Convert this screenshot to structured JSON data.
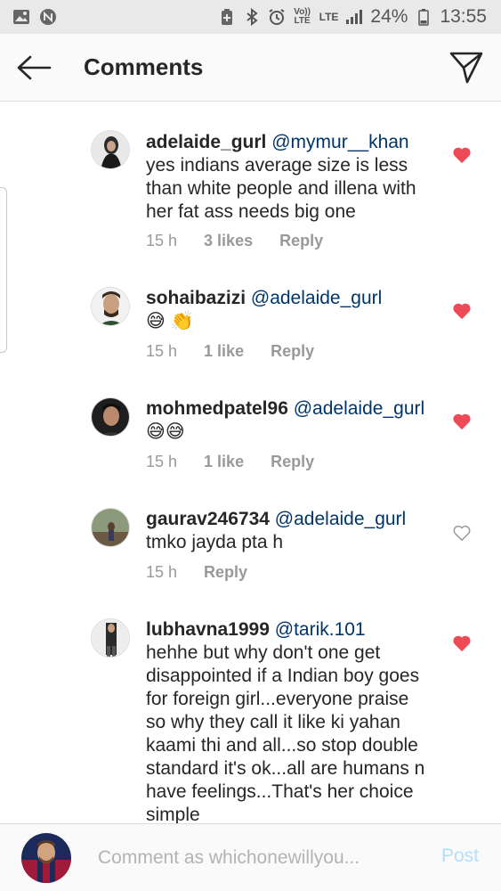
{
  "status_bar": {
    "volte": "Vo)) LTE",
    "lte": "LTE",
    "battery": "24%",
    "time": "13:55",
    "icons": [
      "gallery-icon",
      "navigation-app-icon",
      "battery-saver-icon",
      "bluetooth-icon",
      "alarm-icon",
      "volte-icon",
      "lte-icon",
      "signal-icon",
      "battery-icon"
    ]
  },
  "header": {
    "title": "Comments",
    "back_icon": "back-arrow-icon",
    "send_icon": "direct-send-icon"
  },
  "comments": [
    {
      "username": "adelaide_gurl",
      "mention": "@mymur__khan",
      "text": "yes indians average size is less than white people and illena with her fat ass needs big one",
      "time": "15 h",
      "likes": "3 likes",
      "reply": "Reply",
      "liked": true
    },
    {
      "username": "sohaibazizi",
      "mention": "@adelaide_gurl",
      "text": "😅 👏",
      "time": "15 h",
      "likes": "1 like",
      "reply": "Reply",
      "liked": true
    },
    {
      "username": "mohmedpatel96",
      "mention": "@adelaide_gurl",
      "text": "😅😅",
      "time": "15 h",
      "likes": "1 like",
      "reply": "Reply",
      "liked": true
    },
    {
      "username": "gaurav246734",
      "mention": "@adelaide_gurl",
      "text": "tmko jayda pta h",
      "time": "15 h",
      "likes": "",
      "reply": "Reply",
      "liked": false
    },
    {
      "username": "lubhavna1999",
      "mention": "@tarik.101",
      "text": "hehhe but why don't one get disappointed if a Indian boy goes for foreign girl...everyone praise so why they call it like ki yahan kaami thi and all...so stop double standard it's ok...all are humans n have feelings...That's her choice simple",
      "time": "",
      "likes": "",
      "reply": "",
      "liked": true
    }
  ],
  "composer": {
    "placeholder": "Comment as whichonewillyou...",
    "post_label": "Post"
  },
  "colors": {
    "heart_red": "#ed4956",
    "mention_blue": "#003569",
    "meta_gray": "#999999",
    "post_disabled": "#b2dffc"
  }
}
